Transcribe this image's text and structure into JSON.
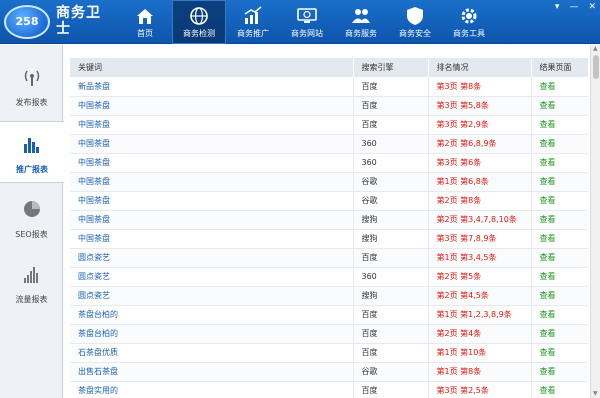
{
  "app": {
    "logo_badge": "258",
    "logo_text": "商务卫士"
  },
  "nav": [
    {
      "label": "首页",
      "icon": "home-icon"
    },
    {
      "label": "商务检测",
      "icon": "globe-icon"
    },
    {
      "label": "商务推广",
      "icon": "bar-chart-icon"
    },
    {
      "label": "商务网站",
      "icon": "monitor-icon"
    },
    {
      "label": "商务服务",
      "icon": "users-icon"
    },
    {
      "label": "商务安全",
      "icon": "shield-icon"
    },
    {
      "label": "商务工具",
      "icon": "gear-icon"
    }
  ],
  "nav_active": 1,
  "window_controls": [
    "▾",
    "—",
    "✕"
  ],
  "sidebar": [
    {
      "label": "发布报表",
      "icon": "broadcast-icon"
    },
    {
      "label": "推广报表",
      "icon": "chart-icon"
    },
    {
      "label": "SEO报表",
      "icon": "pie-icon"
    },
    {
      "label": "流量报表",
      "icon": "traffic-icon"
    }
  ],
  "sidebar_active": 1,
  "table": {
    "headers": [
      "关键词",
      "搜索引擎",
      "排名情况",
      "结果页面"
    ],
    "rows": [
      [
        "新品茶盘",
        "百度",
        "第3页 第8条",
        "查看"
      ],
      [
        "中国茶盘",
        "百度",
        "第3页 第5,8条",
        "查看"
      ],
      [
        "中国茶盘",
        "百度",
        "第3页 第2,9条",
        "查看"
      ],
      [
        "中国茶盘",
        "360",
        "第2页 第6,8,9条",
        "查看"
      ],
      [
        "中国茶盘",
        "360",
        "第3页 第6条",
        "查看"
      ],
      [
        "中国茶盘",
        "谷歌",
        "第1页 第6,8条",
        "查看"
      ],
      [
        "中国茶盘",
        "谷歌",
        "第2页 第8条",
        "查看"
      ],
      [
        "中国茶盘",
        "搜狗",
        "第2页 第3,4,7,8,10条",
        "查看"
      ],
      [
        "中国茶盘",
        "搜狗",
        "第3页 第7,8,9条",
        "查看"
      ],
      [
        "圆点瓷艺",
        "百度",
        "第1页 第3,4,5条",
        "查看"
      ],
      [
        "圆点瓷艺",
        "360",
        "第2页 第5条",
        "查看"
      ],
      [
        "圆点瓷艺",
        "搜狗",
        "第2页 第4,5条",
        "查看"
      ],
      [
        "茶盘台柏的",
        "百度",
        "第1页 第1,2,3,8,9条",
        "查看"
      ],
      [
        "茶盘台柏的",
        "百度",
        "第2页 第4条",
        "查看"
      ],
      [
        "石茶盘优质",
        "百度",
        "第1页 第10条",
        "查看"
      ],
      [
        "出售石茶盘",
        "谷歌",
        "第1页 第8条",
        "查看"
      ],
      [
        "茶盘实用的",
        "百度",
        "第3页 第2,5条",
        "查看"
      ]
    ]
  },
  "colors": {
    "topbar": "#1565c0",
    "keyword": "#1a5fb4",
    "rank": "#e3150f",
    "view": "#1c9a1c"
  }
}
